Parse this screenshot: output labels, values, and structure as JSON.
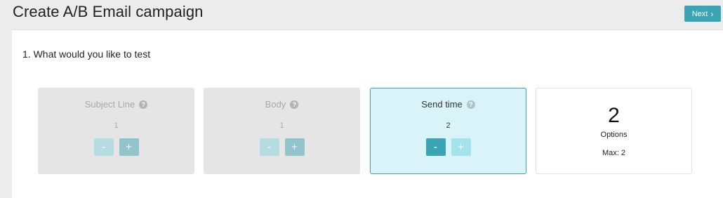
{
  "header": {
    "title": "Create A/B Email campaign",
    "next_label": "Next",
    "next_icon": "›"
  },
  "main": {
    "question": "1. What would you like to test",
    "options": [
      {
        "label": "Subject Line",
        "count": "1",
        "state": "disabled",
        "minus": "-",
        "plus": "+"
      },
      {
        "label": "Body",
        "count": "1",
        "state": "disabled",
        "minus": "-",
        "plus": "+"
      },
      {
        "label": "Send time",
        "count": "2",
        "state": "selected",
        "minus": "-",
        "plus": "+"
      }
    ],
    "summary": {
      "number": "2",
      "label": "Options",
      "max": "Max: 2"
    },
    "help_glyph": "?"
  },
  "colors": {
    "accent": "#3aa4b4",
    "active_bg": "#d9f3f8",
    "disabled_bg": "#e5e5e5",
    "page_bg": "#ececec"
  }
}
